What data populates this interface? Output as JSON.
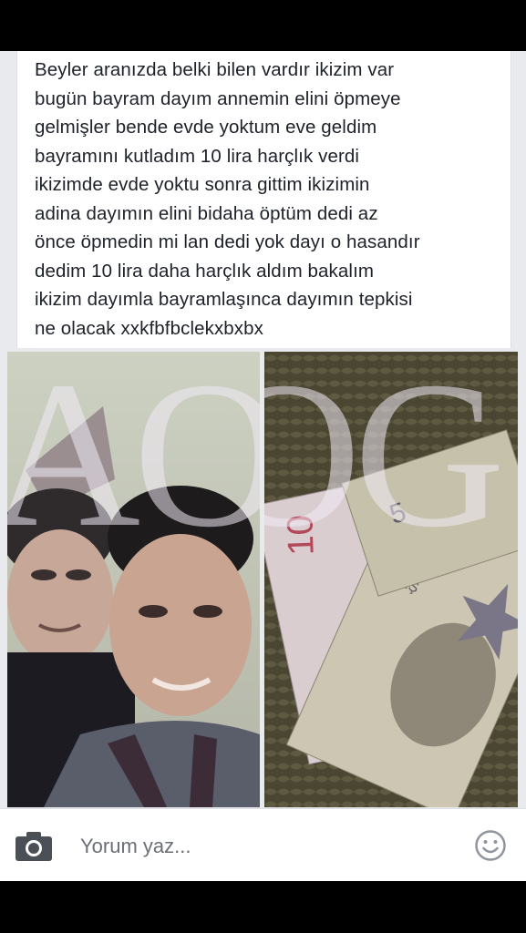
{
  "post": {
    "text": "Beyler aranızda belki bilen vardır ikizim var\nbugün bayram dayım annemin elini öpmeye\ngelmişler bende evde yoktum eve geldim\nbayramını kutladım 10 lira harçlık verdi\nikizimde evde yoktu sonra gittim ikizimin\nadina  dayımın elini bidaha öptüm dedi az\nönce öpmedin mi lan dedi yok dayı o hasandır\ndedim 10 lira daha harçlık aldım bakalım\nikizim dayımla bayramlaşınca dayımın tepkisi\nne olacak xxkfbfbclekxbxbx"
  },
  "photos": {
    "watermark_left": "AO",
    "watermark_right": "OG"
  },
  "comment_bar": {
    "placeholder": "Yorum yaz...",
    "camera_icon": "camera-icon",
    "smiley_icon": "smiley-icon"
  },
  "colors": {
    "background": "#e9eaee",
    "card": "#ffffff",
    "text": "#1d2129",
    "bars": "#000000"
  }
}
